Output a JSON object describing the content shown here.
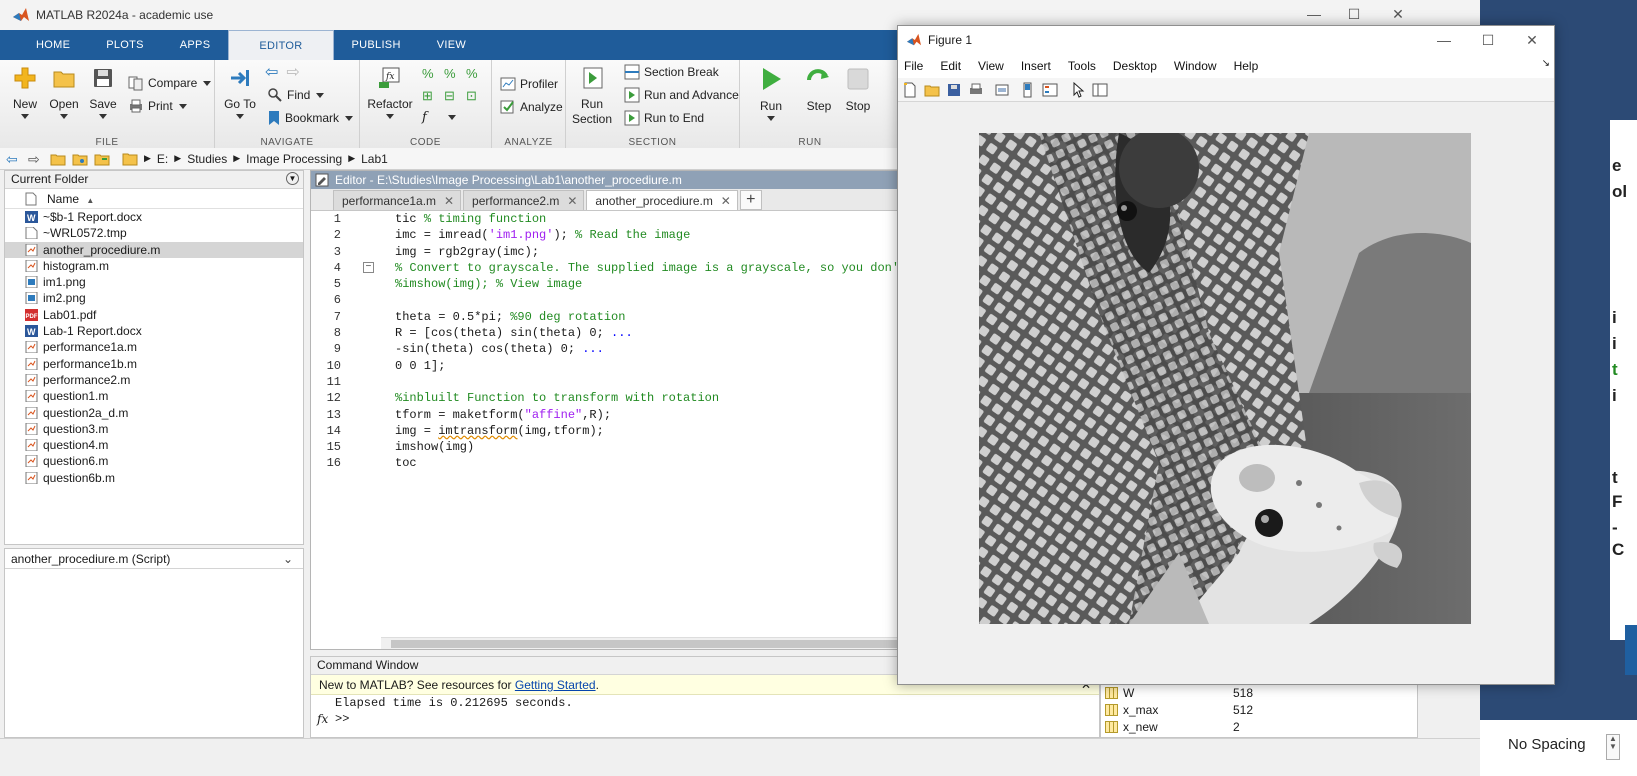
{
  "matlab": {
    "title": "MATLAB R2024a - academic use",
    "tabs": [
      "HOME",
      "PLOTS",
      "APPS",
      "EDITOR",
      "PUBLISH",
      "VIEW"
    ],
    "active_tab": "EDITOR",
    "ribbon": {
      "file": {
        "label": "FILE",
        "new": "New",
        "open": "Open",
        "save": "Save",
        "compare": "Compare",
        "print": "Print"
      },
      "navigate": {
        "label": "NAVIGATE",
        "goto": "Go To",
        "find": "Find",
        "bookmark": "Bookmark"
      },
      "code": {
        "label": "CODE",
        "refactor": "Refactor"
      },
      "analyze": {
        "label": "ANALYZE",
        "profiler": "Profiler",
        "analyze": "Analyze"
      },
      "section": {
        "label": "SECTION",
        "run_section": "Run Section",
        "section_break": "Section Break",
        "run_advance": "Run and Advance",
        "run_end": "Run to End"
      },
      "run": {
        "label": "RUN",
        "run": "Run",
        "step": "Step",
        "stop": "Stop"
      }
    },
    "path": [
      "E:",
      "Studies",
      "Image Processing",
      "Lab1"
    ],
    "current_folder": {
      "title": "Current Folder",
      "column": "Name",
      "files": [
        {
          "name": "~$b-1 Report.docx",
          "type": "word"
        },
        {
          "name": "~WRL0572.tmp",
          "type": "tmp"
        },
        {
          "name": "another_procediure.m",
          "type": "m"
        },
        {
          "name": "histogram.m",
          "type": "m"
        },
        {
          "name": "im1.png",
          "type": "png"
        },
        {
          "name": "im2.png",
          "type": "png"
        },
        {
          "name": "Lab01.pdf",
          "type": "pdf"
        },
        {
          "name": "Lab-1 Report.docx",
          "type": "word"
        },
        {
          "name": "performance1a.m",
          "type": "m"
        },
        {
          "name": "performance1b.m",
          "type": "m"
        },
        {
          "name": "performance2.m",
          "type": "m"
        },
        {
          "name": "question1.m",
          "type": "m"
        },
        {
          "name": "question2a_d.m",
          "type": "m"
        },
        {
          "name": "question3.m",
          "type": "m"
        },
        {
          "name": "question4.m",
          "type": "m"
        },
        {
          "name": "question6.m",
          "type": "m"
        },
        {
          "name": "question6b.m",
          "type": "m"
        }
      ],
      "selected": "another_procediure.m"
    },
    "details": "another_procediure.m  (Script)",
    "editor": {
      "title": "Editor - E:\\Studies\\Image Processing\\Lab1\\another_procediure.m",
      "tabs": [
        "performance1a.m",
        "performance2.m",
        "another_procediure.m"
      ],
      "active_tab": "another_procediure.m",
      "add_tab": "+"
    },
    "command_window": {
      "title": "Command Window",
      "notice": "New to MATLAB? See resources for ",
      "notice_link": "Getting Started",
      "notice_end": ".",
      "output": "Elapsed time is 0.212695 seconds.",
      "prompt": ">>",
      "fx": "fx"
    },
    "workspace": [
      {
        "name": "W",
        "value": "518"
      },
      {
        "name": "x_max",
        "value": "512"
      },
      {
        "name": "x_new",
        "value": "2"
      }
    ]
  },
  "figure": {
    "title": "Figure 1",
    "menu": [
      "File",
      "Edit",
      "View",
      "Insert",
      "Tools",
      "Desktop",
      "Window",
      "Help"
    ]
  },
  "background": {
    "no_spacing": "No Spacing",
    "doc_letters": [
      "e",
      "ol",
      "i",
      "i",
      "t",
      "i",
      "t",
      "F",
      "-",
      "C"
    ]
  },
  "colors": {
    "accent": "#1f5c9a",
    "comment": "#228b22",
    "string": "#a020f0",
    "link": "#0645ad"
  }
}
